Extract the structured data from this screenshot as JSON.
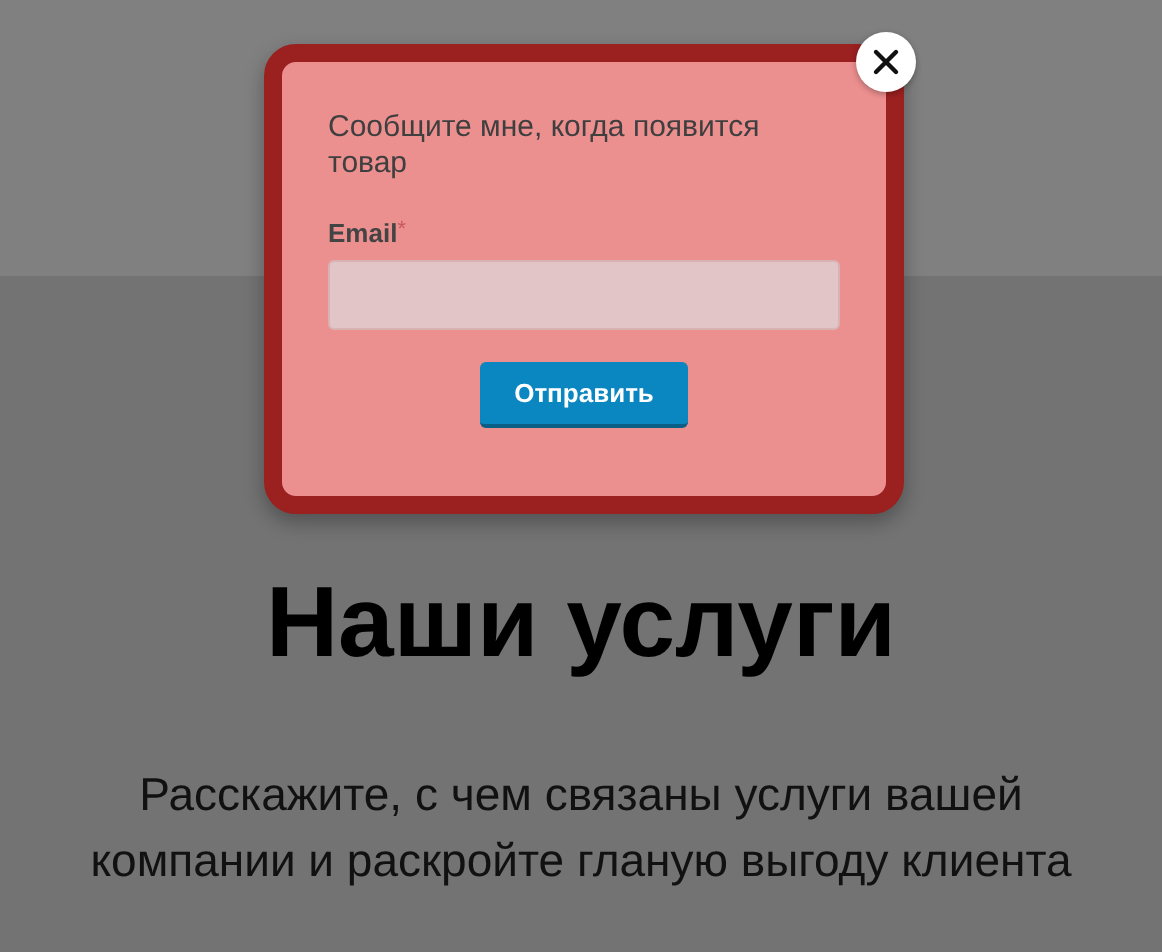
{
  "popup": {
    "message": "Сообщите мне, когда появится товар",
    "field_label": "Email",
    "required_mark": "*",
    "submit": "Отправить"
  },
  "section": {
    "heading": "Наши услуги",
    "text": "Расскажите, с чем связаны услуги вашей компании и раскройте гланую выгоду клиента"
  }
}
